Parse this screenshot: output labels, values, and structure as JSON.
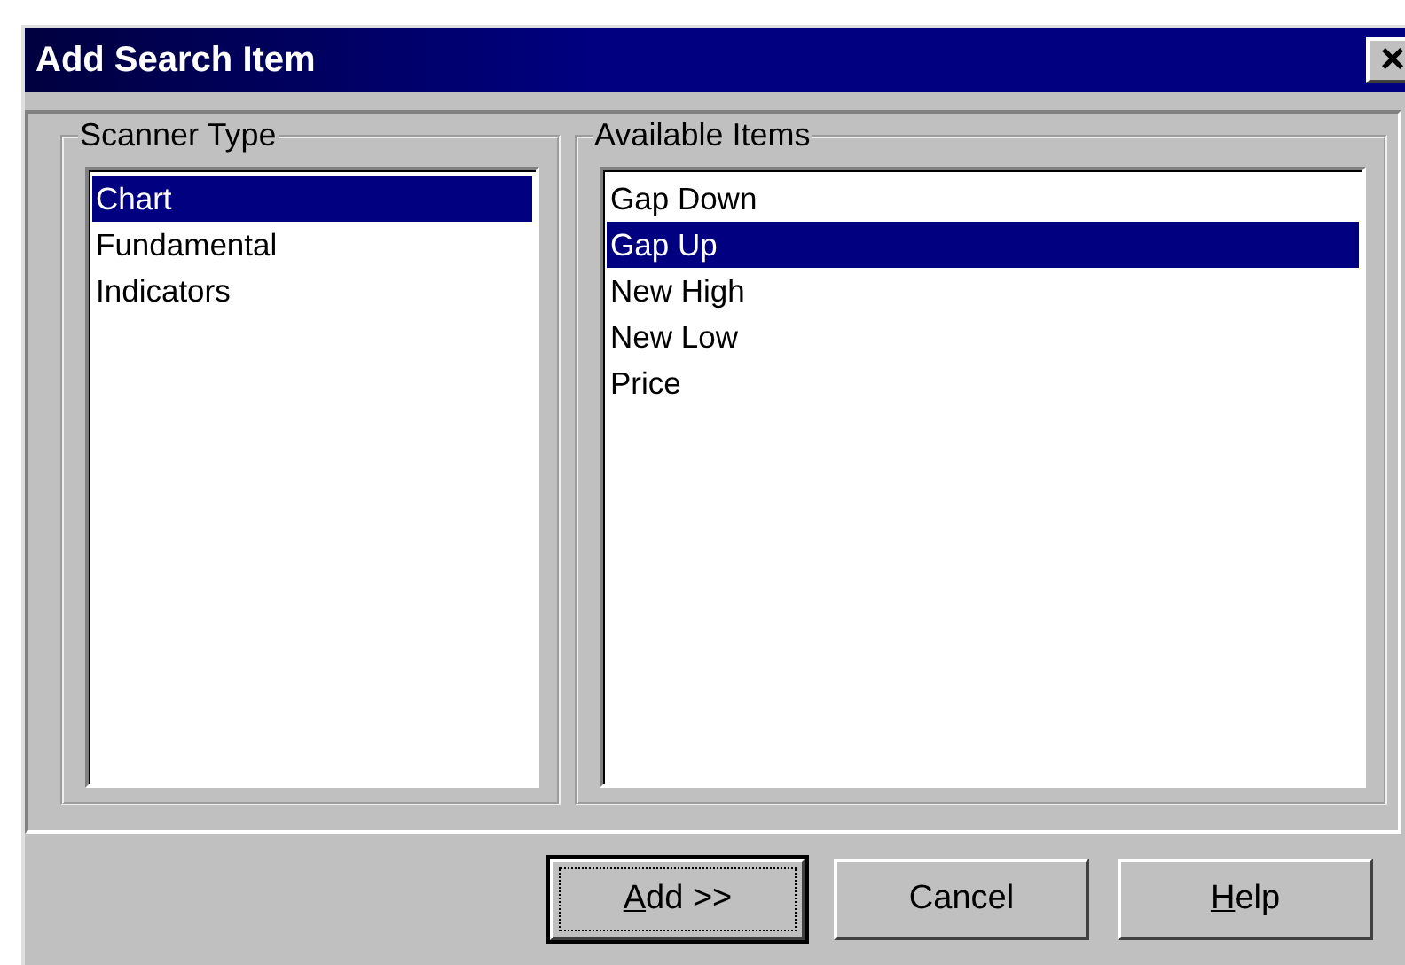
{
  "window": {
    "title": "Add Search Item",
    "close": "×"
  },
  "groups": [
    {
      "label": "Scanner Type",
      "items": [
        {
          "text": "Chart",
          "selected": true
        },
        {
          "text": "Fundamental",
          "selected": false
        },
        {
          "text": "Indicators",
          "selected": false
        }
      ]
    },
    {
      "label": "Available Items",
      "items": [
        {
          "text": "Gap Down",
          "selected": false
        },
        {
          "text": "Gap Up",
          "selected": true
        },
        {
          "text": "New High",
          "selected": false
        },
        {
          "text": "New Low",
          "selected": false
        },
        {
          "text": "Price",
          "selected": false
        }
      ]
    }
  ],
  "buttons": [
    {
      "label": "Add >>",
      "mnemonic": true,
      "default": true
    },
    {
      "label": "Cancel",
      "mnemonic": false,
      "default": false
    },
    {
      "label": "Help",
      "mnemonic": true,
      "default": false
    }
  ]
}
